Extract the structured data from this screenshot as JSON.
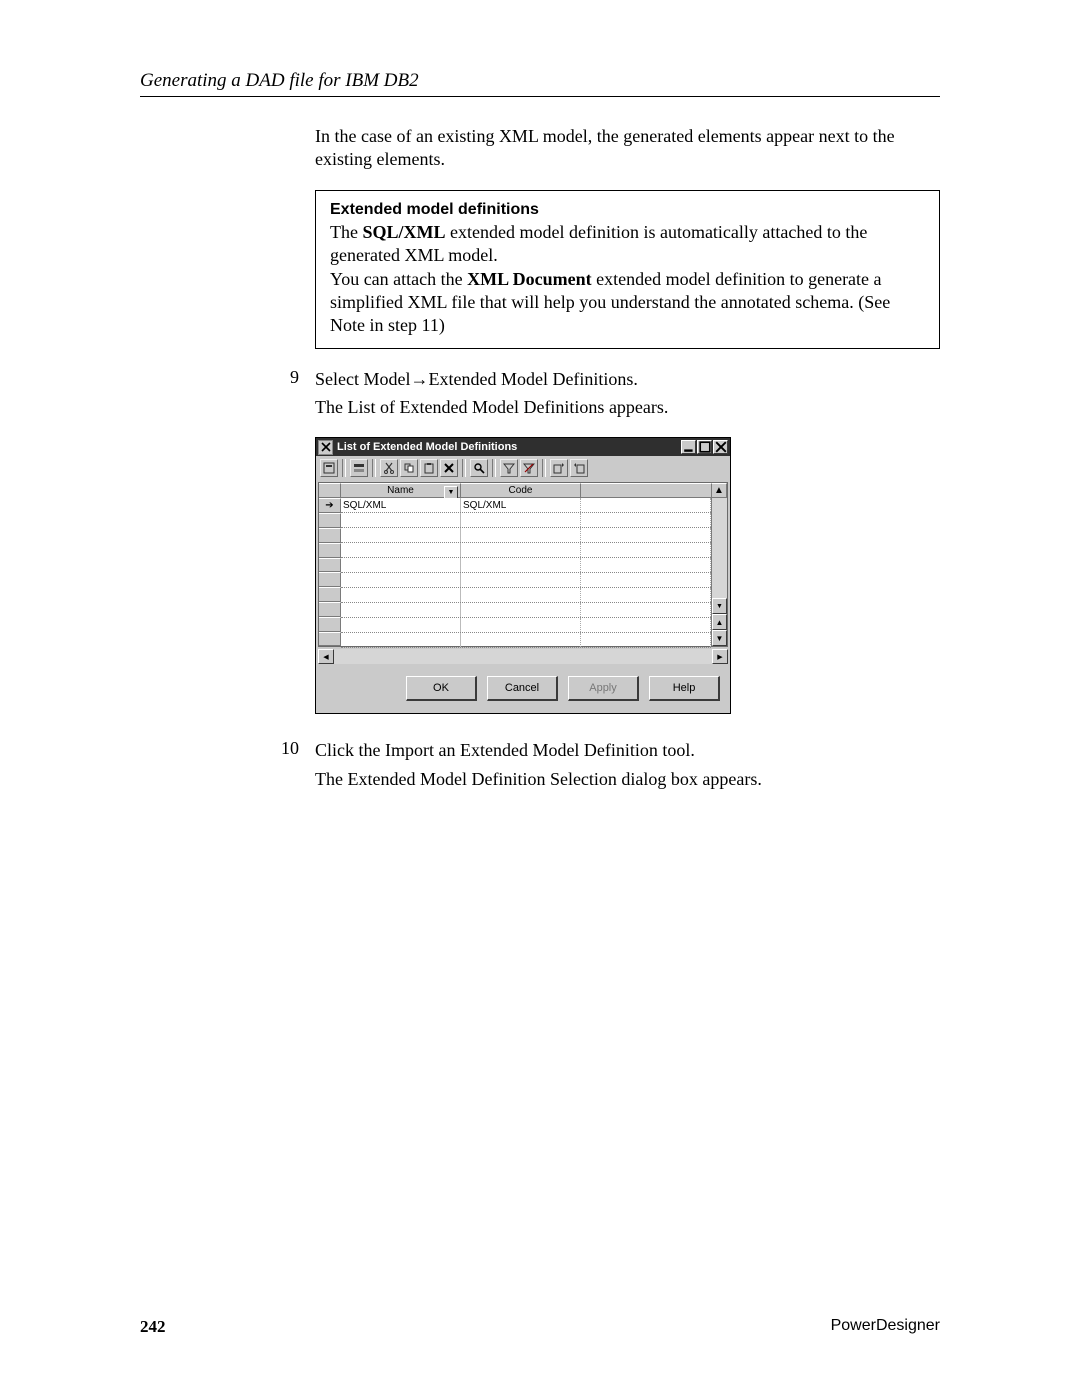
{
  "header": {
    "section_title": "Generating a DAD file for IBM DB2"
  },
  "intro_para": "In the case of an existing XML model, the generated elements appear next to the existing elements.",
  "note": {
    "title": "Extended model definitions",
    "para1_prefix": "The ",
    "para1_bold1": "SQL/XML",
    "para1_mid": " extended model definition is automatically attached to the generated XML model.",
    "para2_prefix": "You can attach the ",
    "para2_bold1": "XML Document",
    "para2_suffix": " extended model definition to generate a simplified XML file that will help you understand the annotated schema. (See Note in step 11)"
  },
  "step9": {
    "num": "9",
    "text": "Select Model→Extended Model Definitions.",
    "sub": "The List of Extended Model Definitions appears."
  },
  "dialog": {
    "title": "List of Extended Model Definitions",
    "columns": {
      "name": "Name",
      "code": "Code"
    },
    "rows": [
      {
        "name": "SQL/XML",
        "code": "SQL/XML"
      }
    ],
    "buttons": {
      "ok": "OK",
      "cancel": "Cancel",
      "apply": "Apply",
      "help": "Help"
    }
  },
  "step10": {
    "num": "10",
    "text": "Click the Import an Extended Model Definition tool.",
    "sub": "The Extended Model Definition Selection dialog box appears."
  },
  "footer": {
    "page_number": "242",
    "product": "PowerDesigner"
  }
}
